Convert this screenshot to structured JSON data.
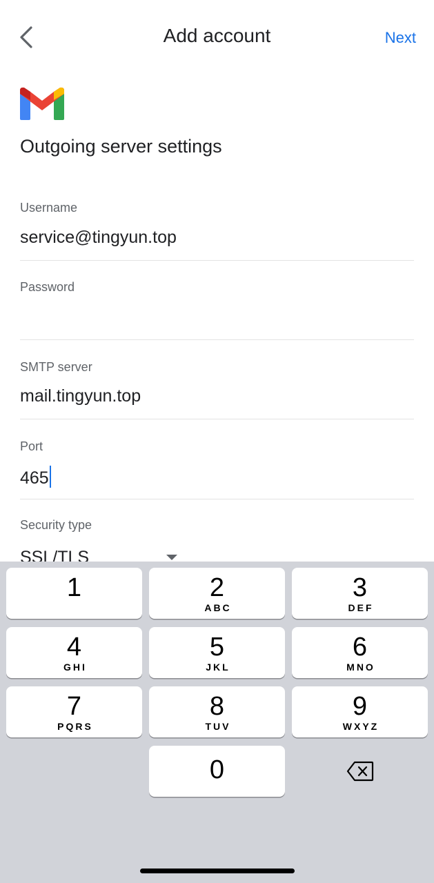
{
  "header": {
    "back_icon": "chevron-left-icon",
    "title": "Add account",
    "next_label": "Next"
  },
  "logo": "gmail-logo",
  "section_title": "Outgoing server settings",
  "fields": {
    "username": {
      "label": "Username",
      "value": "service@tingyun.top"
    },
    "password": {
      "label": "Password",
      "value": ""
    },
    "smtp": {
      "label": "SMTP server",
      "value": "mail.tingyun.top"
    },
    "port": {
      "label": "Port",
      "value": "465"
    },
    "security": {
      "label": "Security type",
      "value": "SSL/TLS"
    }
  },
  "keyboard": {
    "keys": [
      {
        "num": "1",
        "letters": ""
      },
      {
        "num": "2",
        "letters": "ABC"
      },
      {
        "num": "3",
        "letters": "DEF"
      },
      {
        "num": "4",
        "letters": "GHI"
      },
      {
        "num": "5",
        "letters": "JKL"
      },
      {
        "num": "6",
        "letters": "MNO"
      },
      {
        "num": "7",
        "letters": "PQRS"
      },
      {
        "num": "8",
        "letters": "TUV"
      },
      {
        "num": "9",
        "letters": "WXYZ"
      },
      {
        "num": "0",
        "letters": ""
      }
    ],
    "delete_icon": "backspace-icon"
  },
  "colors": {
    "accent": "#1a73e8",
    "keyboard_bg": "#d1d3d9"
  }
}
